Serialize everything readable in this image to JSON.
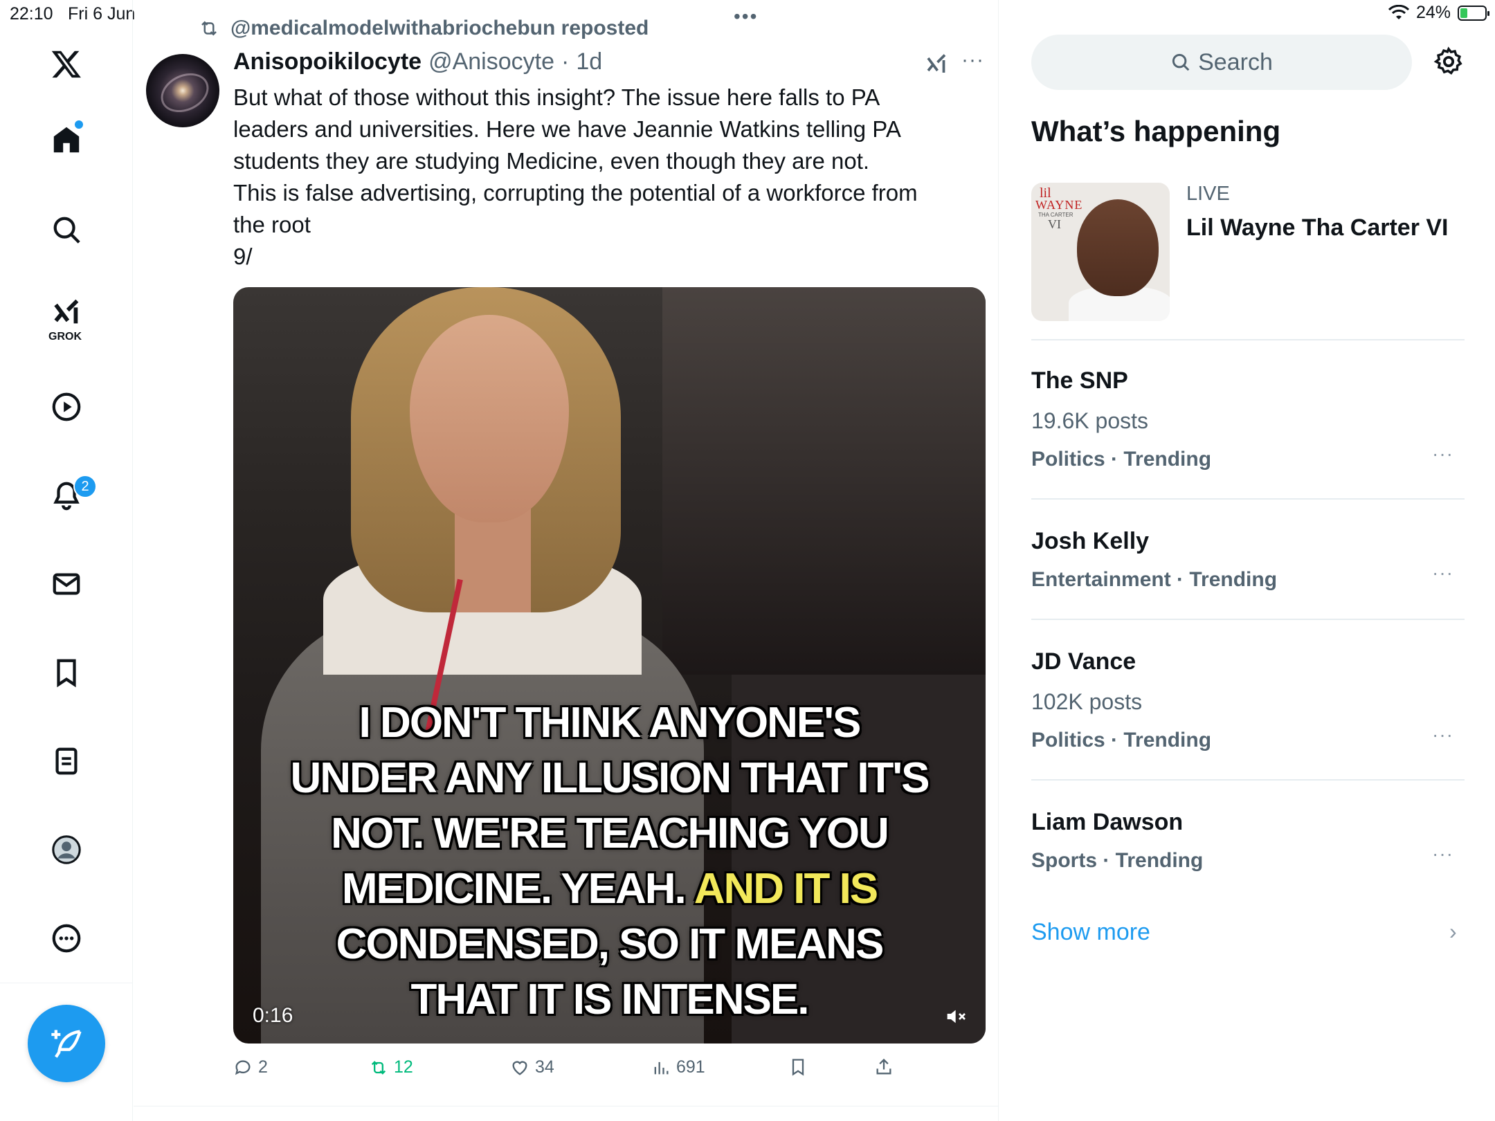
{
  "status_bar": {
    "time": "22:10",
    "date": "Fri 6 Jun",
    "battery_percent": "24%",
    "battery_level": 0.24,
    "top_dots": "•••"
  },
  "nav": {
    "icons": [
      "x-logo-icon",
      "home-icon",
      "search-icon",
      "grok-icon",
      "video-play-icon",
      "notifications-bell-icon",
      "messages-mail-icon",
      "bookmarks-icon",
      "lists-icon",
      "profile-avatar-icon",
      "more-icon"
    ],
    "grok_label": "GROK",
    "notifications_badge": "2",
    "accent_color": "#1d9bf0"
  },
  "tweet": {
    "repost_by": "@medicalmodelwithabriochebun reposted",
    "author_name": "Anisopoikilocyte",
    "author_handle": "@Anisocyte",
    "separator": "·",
    "time": "1d",
    "more": "···",
    "text_lines": [
      "But what of those without this insight? The issue here falls to PA",
      "leaders and universities. Here we have Jeannie Watkins telling PA",
      "students they are studying Medicine, even though they are not.",
      "This is false advertising, corrupting the potential of a workforce from",
      "the root",
      "9/"
    ],
    "video": {
      "caption_lines": [
        "I DON'T THINK ANYONE'S",
        "UNDER ANY ILLUSION THAT IT'S",
        "NOT. WE'RE TEACHING YOU",
        "MEDICINE. YEAH. ",
        "CONDENSED, SO IT MEANS",
        "THAT IT IS INTENSE."
      ],
      "caption_highlight": "AND IT IS",
      "caption_highlight_color": "#f2e85a",
      "timestamp": "0:16",
      "muted": true
    },
    "actions": {
      "replies": "2",
      "reposts": "12",
      "likes": "34",
      "views": "691",
      "repost_color": "#00ba7c"
    }
  },
  "sidebar": {
    "search_placeholder": "Search",
    "section_title": "What’s happening",
    "live": {
      "label": "LIVE",
      "title": "Lil Wayne Tha Carter VI",
      "art_text_1": "lil",
      "art_text_2": "WAYNE",
      "art_text_3": "THA CARTER",
      "art_text_4": "VI"
    },
    "trends": [
      {
        "name": "The SNP",
        "count": "19.6K posts",
        "category": "Politics · Trending"
      },
      {
        "name": "Josh Kelly",
        "count": "",
        "category": "Entertainment · Trending"
      },
      {
        "name": "JD Vance",
        "count": "102K posts",
        "category": "Politics · Trending"
      },
      {
        "name": "Liam Dawson",
        "count": "",
        "category": "Sports · Trending"
      }
    ],
    "trend_more": "···",
    "show_more": "Show more",
    "show_more_chevron": "›"
  }
}
